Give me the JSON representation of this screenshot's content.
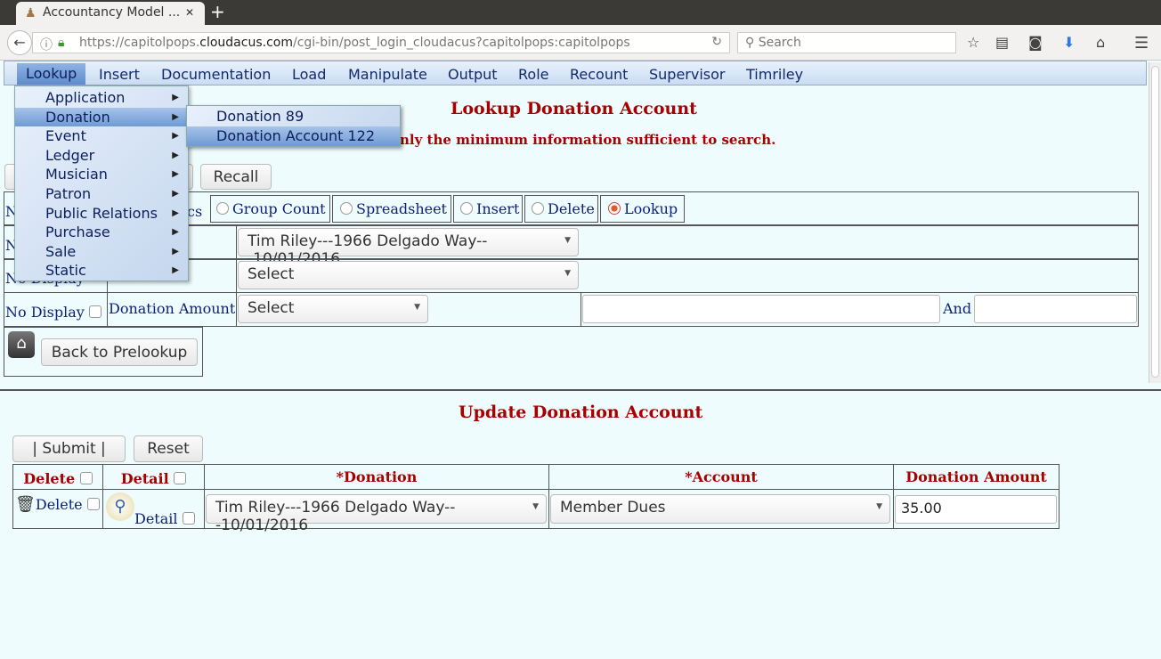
{
  "browser": {
    "tab_title": "Accountancy Model ...",
    "url_prefix": "https://capitolpops.",
    "url_domain": "cloudacus.com",
    "url_path": "/cgi-bin/post_login_cloudacus?capitolpops:capitolpops",
    "search_placeholder": "Search"
  },
  "menubar": {
    "items": [
      "Lookup",
      "Insert",
      "Documentation",
      "Load",
      "Manipulate",
      "Output",
      "Role",
      "Recount",
      "Supervisor",
      "Timriley"
    ]
  },
  "lookup_menu": {
    "items": [
      "Application",
      "Donation",
      "Event",
      "Ledger",
      "Musician",
      "Patron",
      "Public Relations",
      "Purchase",
      "Sale",
      "Static"
    ],
    "highlighted": "Donation"
  },
  "donation_submenu": {
    "items": [
      "Donation 89",
      "Donation Account 122"
    ],
    "highlighted": "Donation Account 122"
  },
  "lookup": {
    "title": "Lookup Donation Account",
    "instructions": "nly the minimum information sufficient to search.",
    "recall_label": "Recall",
    "modes": {
      "partial": "cs",
      "options": [
        "Group Count",
        "Spreadsheet",
        "Insert",
        "Delete",
        "Lookup"
      ],
      "selected": "Lookup"
    },
    "row_prefix": "N",
    "donation_select": "Tim Riley---1966 Delgado Way---10/01/2016",
    "account_select": "Select",
    "no_display": "No Display",
    "amount_label": "Donation Amount",
    "amount_select": "Select",
    "and_label": "And",
    "back_label": "Back to Prelookup"
  },
  "update": {
    "title": "Update Donation Account",
    "submit_label": "|   Submit   |",
    "reset_label": "Reset",
    "headers": [
      "Delete",
      "Detail",
      "*Donation",
      "*Account",
      "Donation Amount"
    ],
    "row": {
      "delete": "Delete",
      "detail": "Detail",
      "donation": "Tim Riley---1966 Delgado Way---10/01/2016",
      "account": "Member Dues",
      "amount": "35.00"
    }
  },
  "colors": {
    "heading": "#a80000",
    "label": "#0b1f7a",
    "background": "#effcfd"
  }
}
